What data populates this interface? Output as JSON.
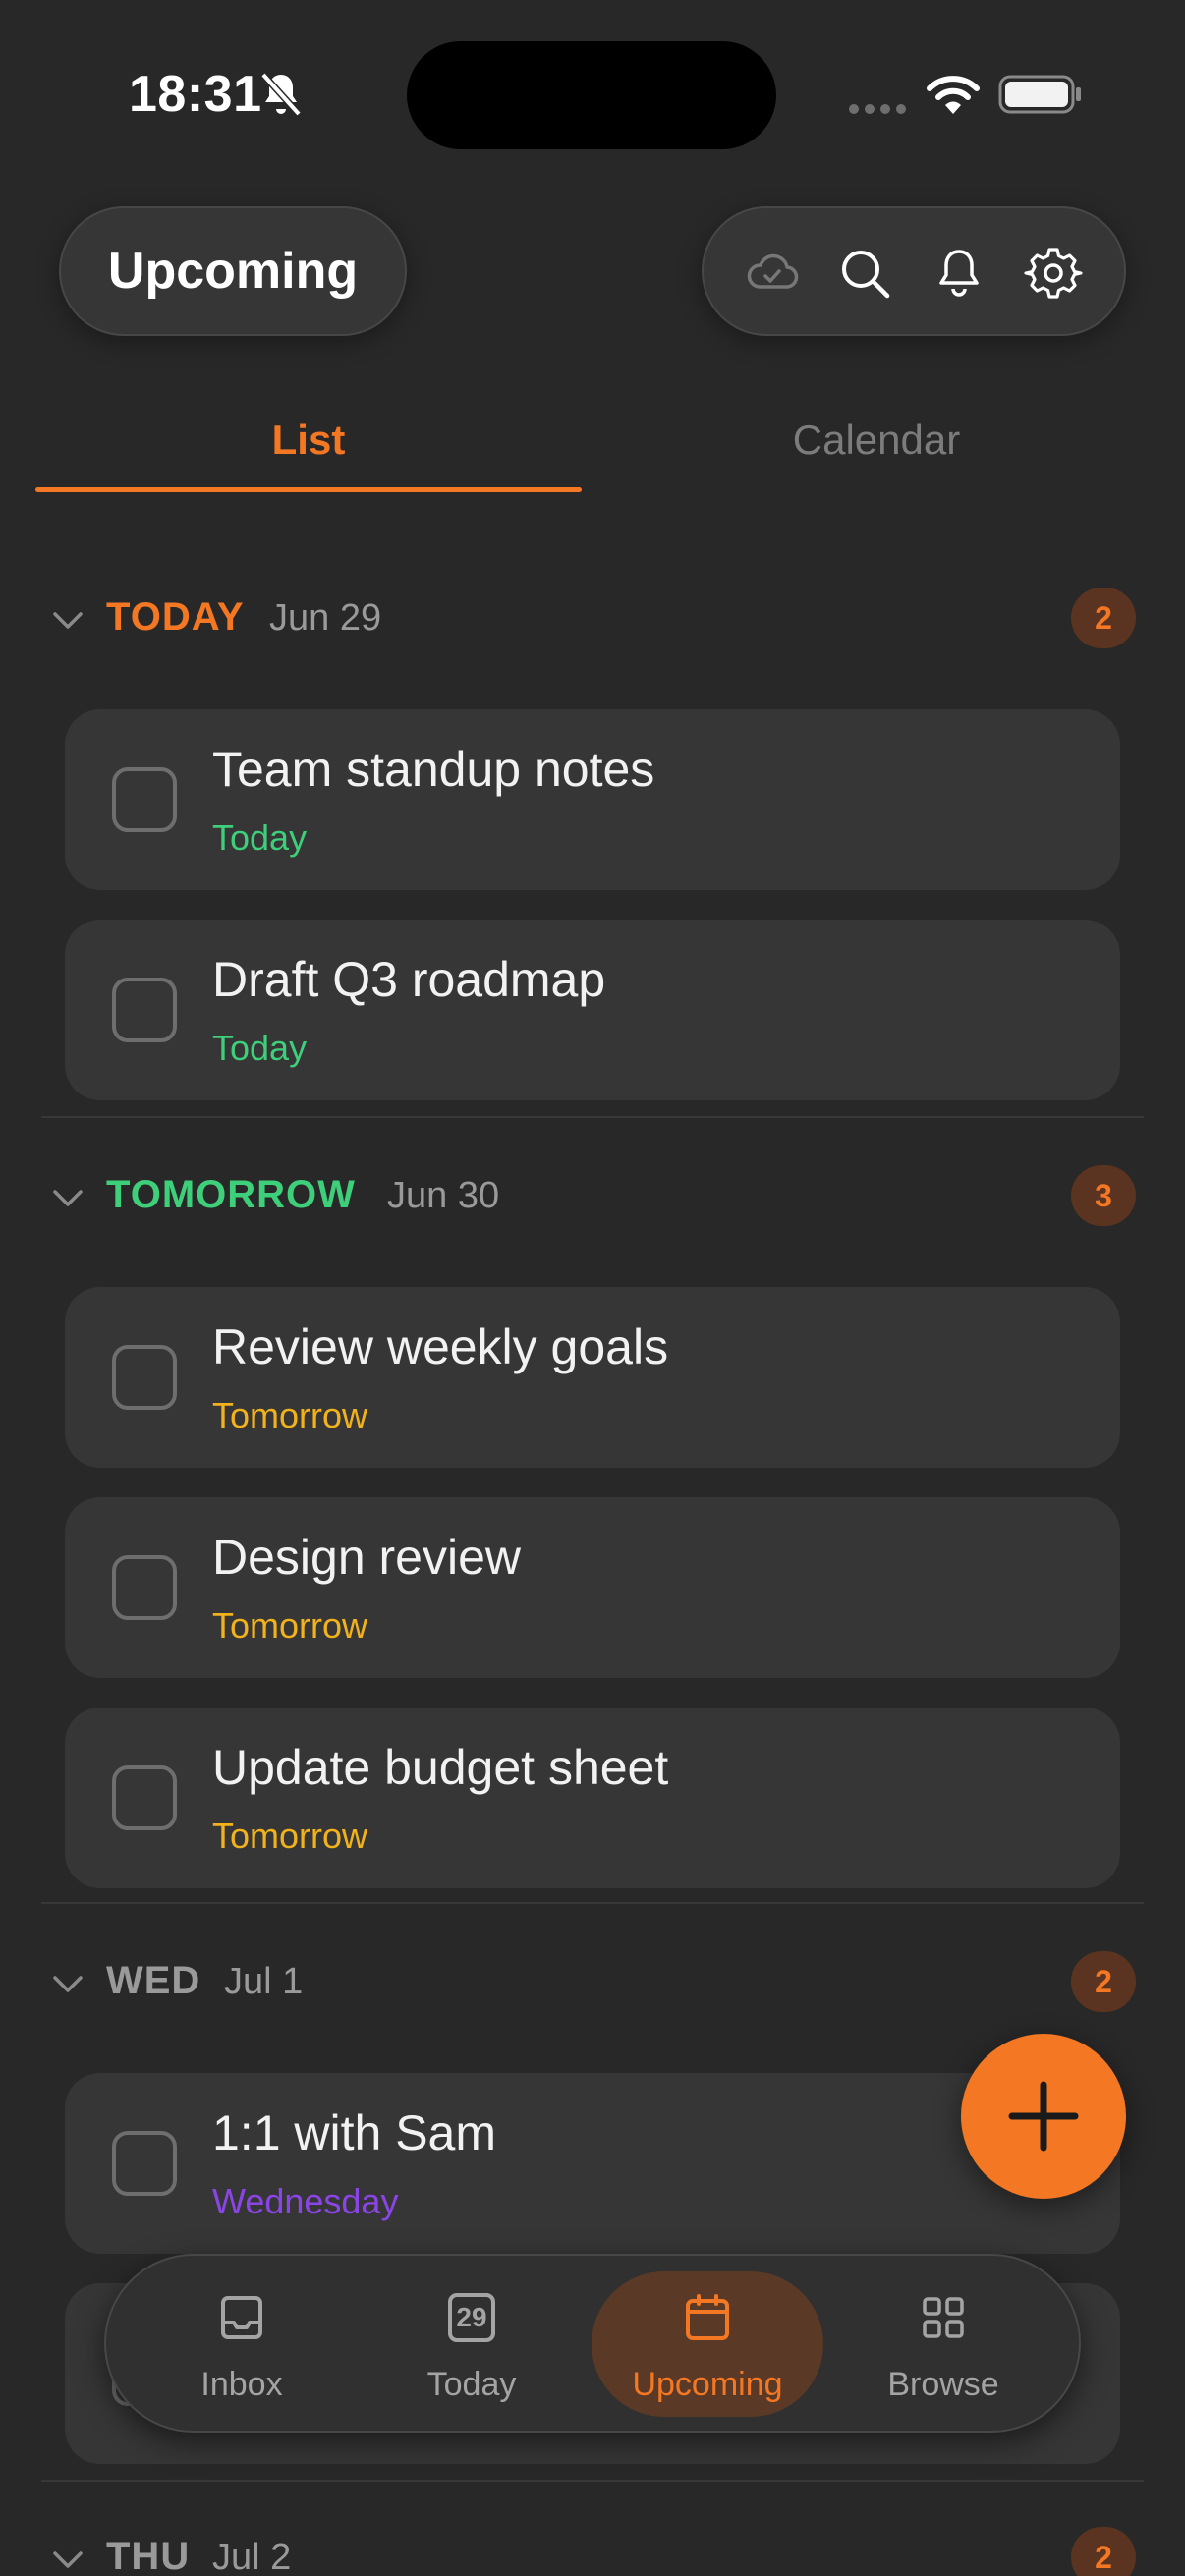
{
  "status_bar": {
    "time": "18:31",
    "icons": [
      "bell-slash-icon",
      "signal-dots-icon",
      "wifi-icon",
      "battery-icon"
    ]
  },
  "header": {
    "title": "Upcoming",
    "actions": [
      "cloud-sync-icon",
      "search-icon",
      "bell-icon",
      "gear-icon"
    ]
  },
  "tabs": [
    {
      "label": "List",
      "active": true
    },
    {
      "label": "Calendar",
      "active": false
    }
  ],
  "sections": [
    {
      "label": "TODAY",
      "date": "Jun 29",
      "count": "2",
      "color": "#f47823",
      "tasks": [
        {
          "title": "Team standup notes",
          "due": "Today",
          "due_color": "#3ecf7a"
        },
        {
          "title": "Draft Q3 roadmap",
          "due": "Today",
          "due_color": "#3ecf7a"
        }
      ]
    },
    {
      "label": "TOMORROW",
      "date": "Jun 30",
      "count": "3",
      "color": "#3ecf7a",
      "tasks": [
        {
          "title": "Review weekly goals",
          "due": "Tomorrow",
          "due_color": "#f2b21b"
        },
        {
          "title": "Design review",
          "due": "Tomorrow",
          "due_color": "#f2b21b"
        },
        {
          "title": "Update budget sheet",
          "due": "Tomorrow",
          "due_color": "#f2b21b"
        }
      ]
    },
    {
      "label": "WED",
      "date": "Jul 1",
      "count": "2",
      "color": "#9a9a9a",
      "tasks": [
        {
          "title": "1:1 with Sam",
          "due": "Wednesday",
          "due_color": "#8b45e6"
        }
      ]
    },
    {
      "label": "THU",
      "date": "Jul 2",
      "count": "2",
      "color": "#9a9a9a",
      "tasks": []
    }
  ],
  "fab": {
    "icon": "plus-icon",
    "color": "#f47823"
  },
  "bottom_nav": [
    {
      "label": "Inbox",
      "icon": "inbox-icon",
      "active": false
    },
    {
      "label": "Today",
      "icon": "calendar-day-icon",
      "day_number": "29",
      "active": false
    },
    {
      "label": "Upcoming",
      "icon": "calendar-icon",
      "active": true
    },
    {
      "label": "Browse",
      "icon": "grid-icon",
      "active": false
    }
  ],
  "colors": {
    "background": "#282828",
    "card": "#363636",
    "accent": "#f47823"
  }
}
